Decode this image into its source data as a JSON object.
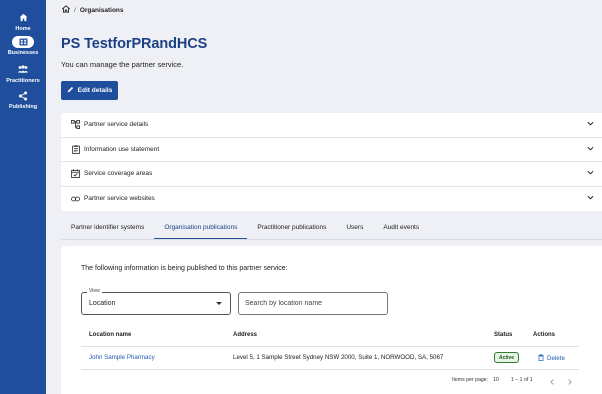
{
  "sidebar": {
    "items": [
      {
        "label": "Home",
        "icon": "home-icon"
      },
      {
        "label": "Businesses",
        "icon": "business-icon",
        "active": true
      },
      {
        "label": "Practitioners",
        "icon": "people-icon"
      },
      {
        "label": "Publishing",
        "icon": "share-icon"
      }
    ]
  },
  "breadcrumb": {
    "separator": "/",
    "current": "Organisations"
  },
  "page": {
    "title": "PS TestforPRandHCS",
    "subtitle": "You can manage the partner service.",
    "edit_label": "Edit details"
  },
  "accordion": [
    {
      "label": "Partner service details",
      "icon": "hierarchy-icon"
    },
    {
      "label": "Information use statement",
      "icon": "clipboard-icon"
    },
    {
      "label": "Service coverage areas",
      "icon": "calendar-check-icon"
    },
    {
      "label": "Partner service websites",
      "icon": "link-icon"
    }
  ],
  "tabs": [
    {
      "label": "Partner identifier systems"
    },
    {
      "label": "Organisation publications",
      "active": true
    },
    {
      "label": "Practitioner publications"
    },
    {
      "label": "Users"
    },
    {
      "label": "Audit events"
    }
  ],
  "publications": {
    "intro": "The following information is being published to this partner service:",
    "view_legend": "View",
    "view_value": "Location",
    "search_placeholder": "Search by location name",
    "columns": [
      "Location name",
      "Address",
      "Status",
      "Actions"
    ],
    "rows": [
      {
        "location": "John Sample Pharmacy",
        "address": "Level 5, 1 Sample Street Sydney NSW 2000, Suite 1, NORWOOD, SA, 5067",
        "status": "Active",
        "action": "Delete"
      }
    ],
    "pager": {
      "items_per_page_label": "Items per page:",
      "items_per_page": "10",
      "range": "1 – 1 of 1"
    }
  },
  "colors": {
    "brand": "#1f4e9c",
    "title": "#1c3f86",
    "link": "#1f5fae",
    "active_green": "#2e7d32"
  }
}
